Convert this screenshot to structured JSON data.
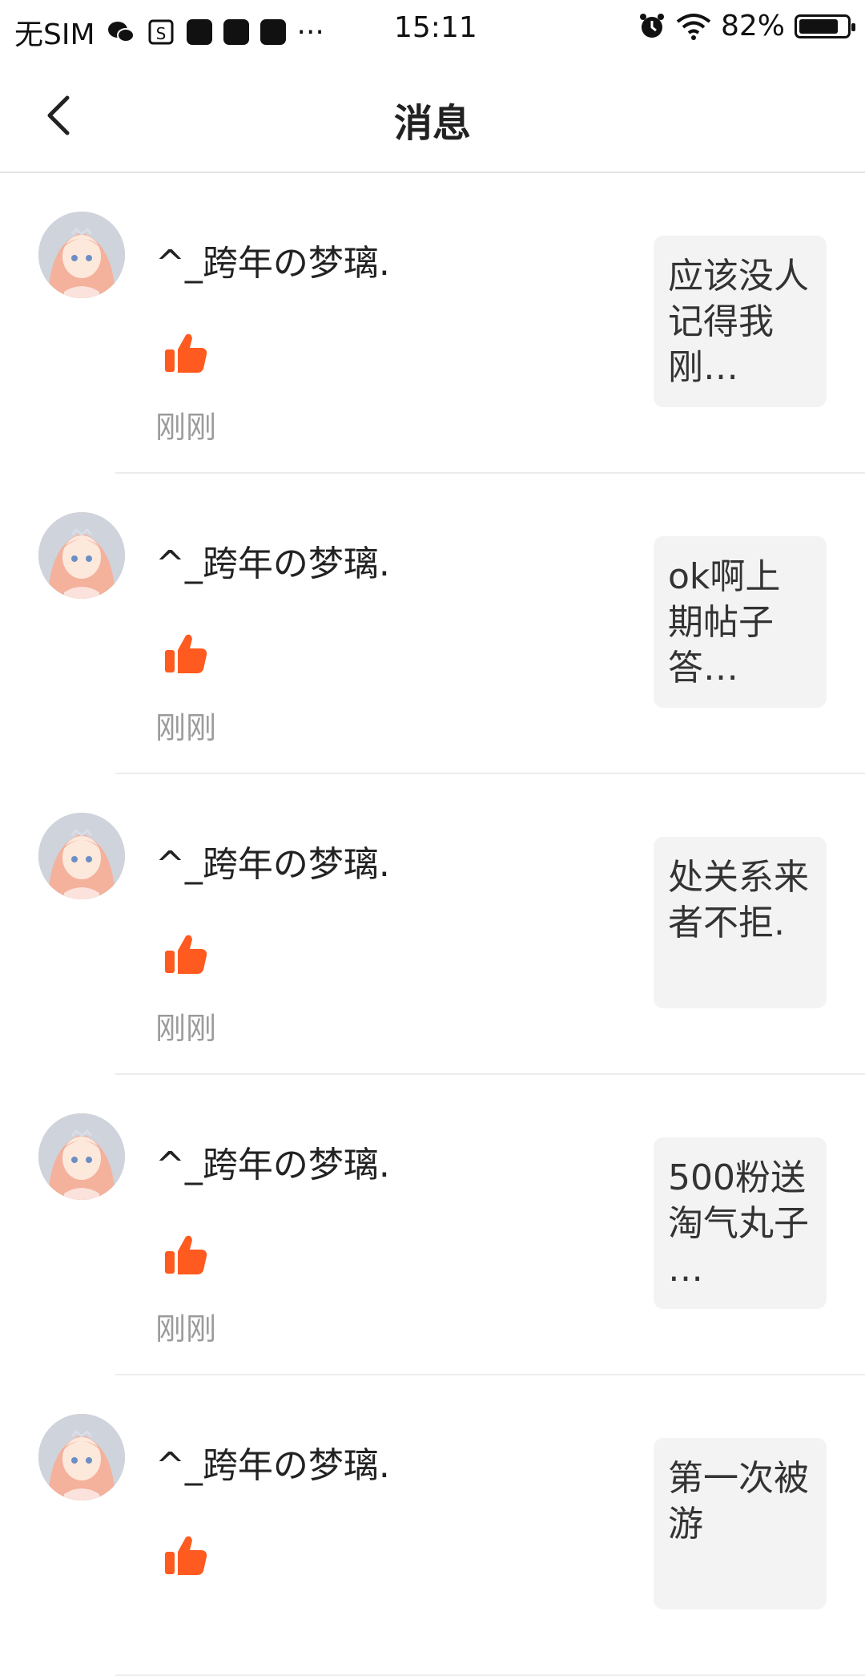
{
  "status_bar": {
    "carrier": "无SIM",
    "more": "···",
    "time": "15:11",
    "battery": "82%",
    "battery_level": 0.82
  },
  "header": {
    "title": "消息",
    "back_icon": "chevron-left-icon"
  },
  "colors": {
    "like": "#ff5a1f",
    "time_text": "#9b9b9b",
    "preview_bg": "#f3f3f3"
  },
  "items": [
    {
      "username": "^_跨年の梦璃.",
      "time": "刚刚",
      "preview": "应该没人记得我刚…",
      "icon": "thumbs-up-icon"
    },
    {
      "username": "^_跨年の梦璃.",
      "time": "刚刚",
      "preview": "ok啊上期帖子答…",
      "icon": "thumbs-up-icon"
    },
    {
      "username": "^_跨年の梦璃.",
      "time": "刚刚",
      "preview": "处关系来者不拒.",
      "icon": "thumbs-up-icon"
    },
    {
      "username": "^_跨年の梦璃.",
      "time": "刚刚",
      "preview": "500粉送淘气丸子 …",
      "icon": "thumbs-up-icon"
    },
    {
      "username": "^_跨年の梦璃.",
      "time": "",
      "preview": "第一次被游",
      "icon": "thumbs-up-icon"
    }
  ]
}
